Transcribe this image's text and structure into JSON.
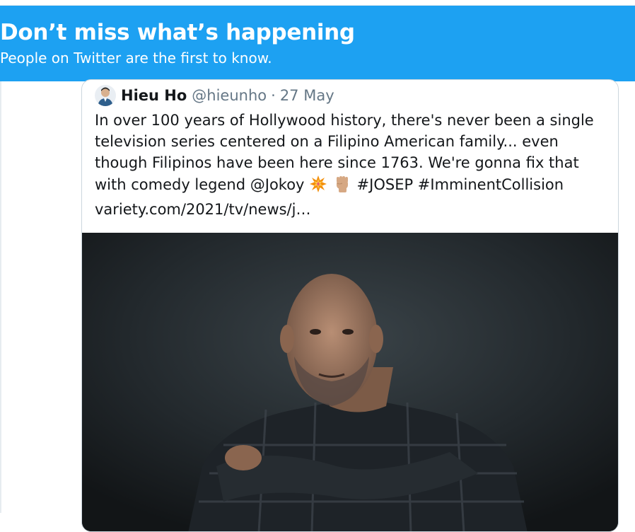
{
  "banner": {
    "title": "Don’t miss what’s happening",
    "subtitle": "People on Twitter are the first to know.",
    "color": "#1da1f2"
  },
  "tweet": {
    "author_name": "Hieu Ho",
    "author_handle": "@hieunho",
    "separator": "·",
    "date": "27 May",
    "text_main": "In over 100 years of Hollywood history, there's never been a single television series centered on a Filipino American family... even though Filipinos have been here since 1763. We're gonna fix that with comedy legend @Jokoy",
    "hashtags": "#JOSEP #ImminentCollision",
    "link": "variety.com/2021/tv/news/j…",
    "emojis": [
      "collision-icon",
      "raised-fist-icon"
    ],
    "media": "photo"
  }
}
